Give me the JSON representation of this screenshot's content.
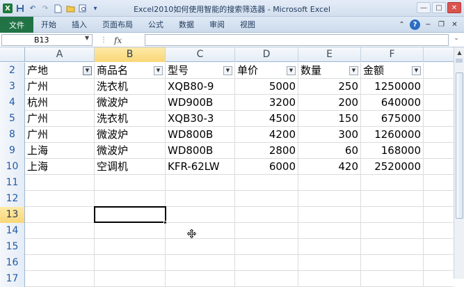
{
  "window": {
    "title": "Excel2010如何使用智能的搜索筛选器 - Microsoft Excel",
    "controls": [
      "—",
      "□",
      "✕"
    ]
  },
  "quick_access": {
    "app_icon": "X",
    "icons": [
      "excel-logo-icon",
      "save-icon",
      "undo-icon",
      "redo-icon",
      "new-icon",
      "open-icon",
      "print-preview-icon",
      "customize-icon"
    ]
  },
  "ribbon": {
    "file_tab": "文件",
    "tabs": [
      "开始",
      "插入",
      "页面布局",
      "公式",
      "数据",
      "审阅",
      "视图"
    ]
  },
  "formula_bar": {
    "name_box": "B13",
    "fx_label": "fx",
    "formula": ""
  },
  "sheet": {
    "columns": [
      "A",
      "B",
      "C",
      "D",
      "E",
      "F"
    ],
    "selected_column": "B",
    "active_cell": "B13",
    "rows": [
      {
        "n": "2",
        "cells": [
          "产地",
          "商品名",
          "型号",
          "单价",
          "数量",
          "金额"
        ],
        "header": true
      },
      {
        "n": "3",
        "cells": [
          "广州",
          "洗衣机",
          "XQB80-9",
          "5000",
          "250",
          "1250000"
        ]
      },
      {
        "n": "4",
        "cells": [
          "杭州",
          "微波炉",
          "WD900B",
          "3200",
          "200",
          "640000"
        ]
      },
      {
        "n": "5",
        "cells": [
          "广州",
          "洗衣机",
          "XQB30-3",
          "4500",
          "150",
          "675000"
        ]
      },
      {
        "n": "8",
        "cells": [
          "广州",
          "微波炉",
          "WD800B",
          "4200",
          "300",
          "1260000"
        ]
      },
      {
        "n": "9",
        "cells": [
          "上海",
          "微波炉",
          "WD800B",
          "2800",
          "60",
          "168000"
        ]
      },
      {
        "n": "10",
        "cells": [
          "上海",
          "空调机",
          "KFR-62LW",
          "6000",
          "420",
          "2520000"
        ]
      },
      {
        "n": "11",
        "cells": [
          "",
          "",
          "",
          "",
          "",
          ""
        ]
      },
      {
        "n": "12",
        "cells": [
          "",
          "",
          "",
          "",
          "",
          ""
        ]
      },
      {
        "n": "13",
        "cells": [
          "",
          "",
          "",
          "",
          "",
          ""
        ]
      },
      {
        "n": "14",
        "cells": [
          "",
          "",
          "",
          "",
          "",
          ""
        ]
      },
      {
        "n": "15",
        "cells": [
          "",
          "",
          "",
          "",
          "",
          ""
        ]
      },
      {
        "n": "16",
        "cells": [
          "",
          "",
          "",
          "",
          "",
          ""
        ]
      },
      {
        "n": "17",
        "cells": [
          "",
          "",
          "",
          "",
          "",
          ""
        ]
      }
    ],
    "filtered_column": "A"
  },
  "colors": {
    "file_tab": "#217346",
    "selection_header": "#f9d777",
    "row_number": "#1f5aa6"
  }
}
